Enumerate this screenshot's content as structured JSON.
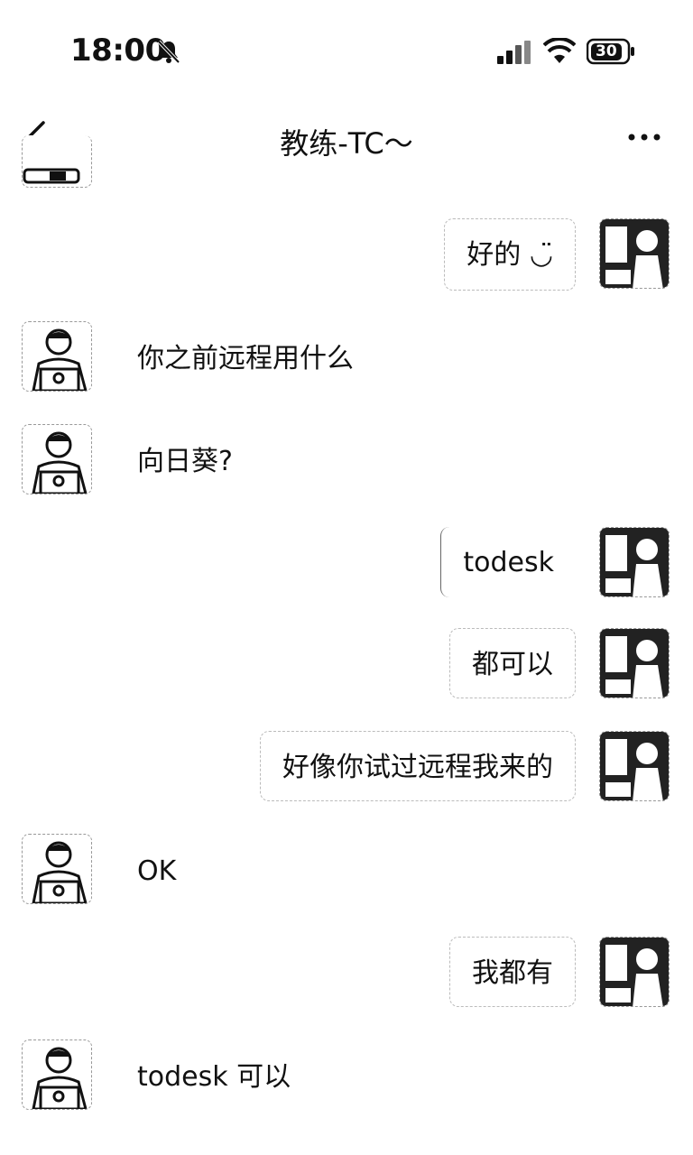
{
  "status_bar": {
    "time": "18:00",
    "battery_level": "30",
    "icons": [
      "bell-mute-icon",
      "signal-icon",
      "wifi-icon",
      "battery-icon"
    ]
  },
  "nav": {
    "title": "教练-TC～",
    "back_icon": "chevron-left-icon",
    "more_icon": "more-icon"
  },
  "messages": [
    {
      "from": "me",
      "text": "好的 ◡̈"
    },
    {
      "from": "them",
      "text": "你之前远程用什么"
    },
    {
      "from": "them",
      "text": "向日葵?"
    },
    {
      "from": "me",
      "text": "todesk"
    },
    {
      "from": "me",
      "text": "都可以"
    },
    {
      "from": "me",
      "text": "好像你试过远程我来的"
    },
    {
      "from": "them",
      "text": "OK"
    },
    {
      "from": "me",
      "text": "我都有"
    },
    {
      "from": "them",
      "text": "todesk 可以"
    }
  ]
}
